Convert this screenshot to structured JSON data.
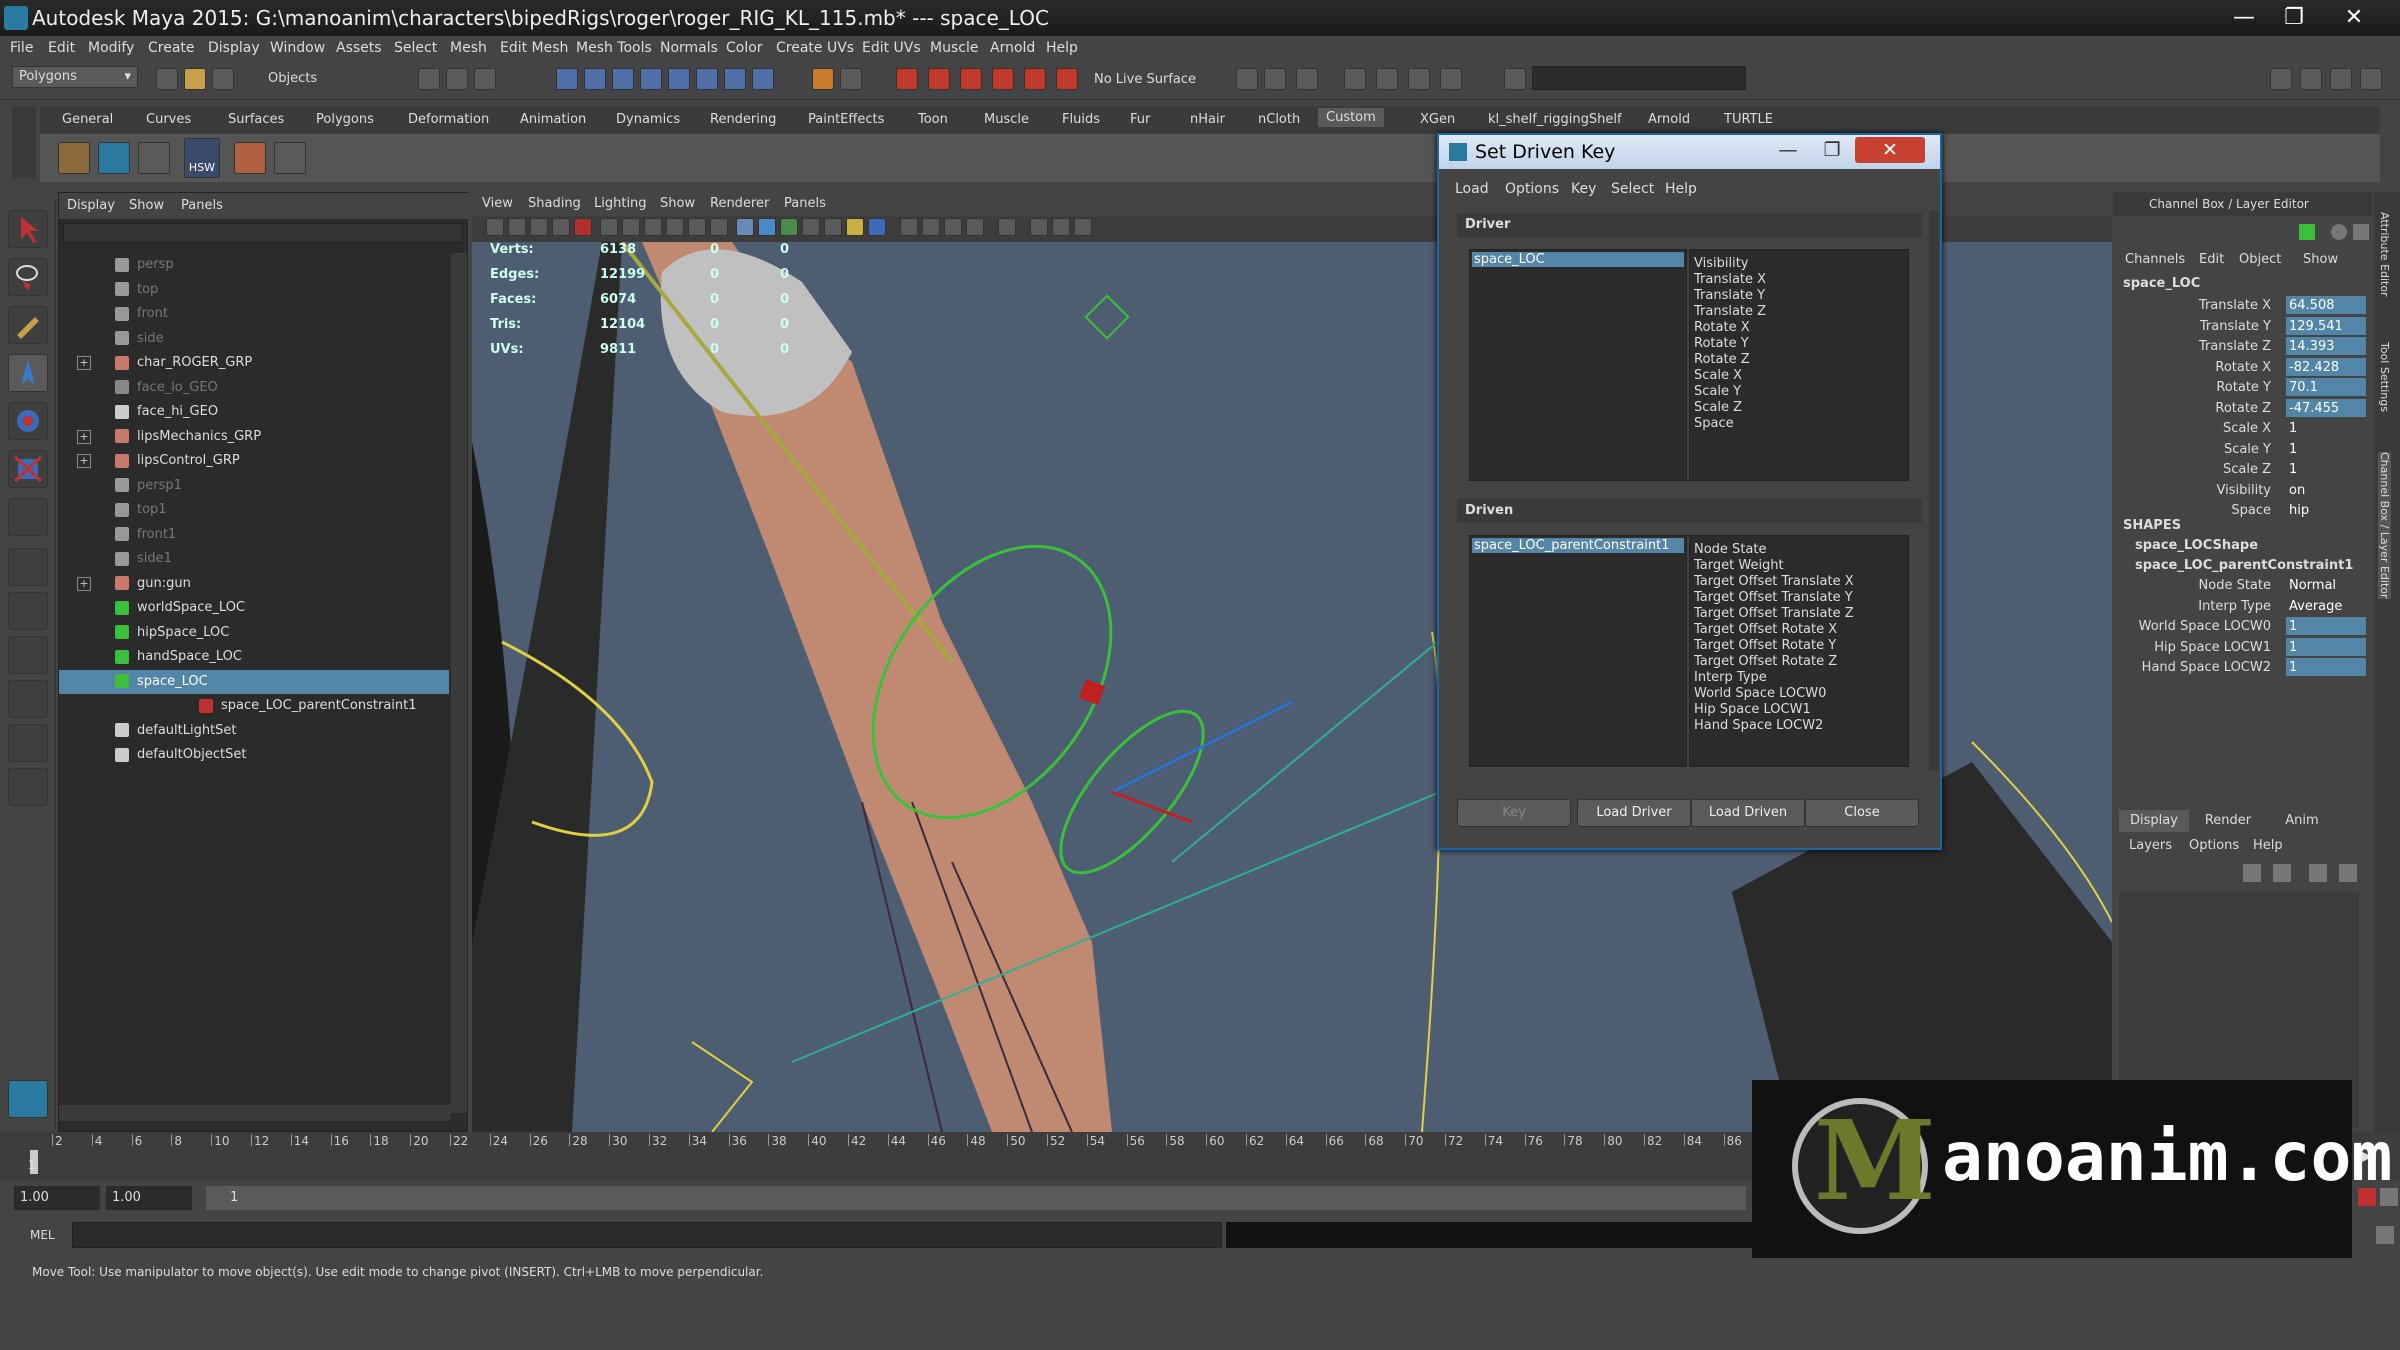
{
  "window": {
    "title": "Autodesk Maya 2015: G:\\manoanim\\characters\\bipedRigs\\roger\\roger_RIG_KL_115.mb*   ---   space_LOC",
    "controls": [
      "—",
      "❐",
      "✕"
    ]
  },
  "menubar": [
    "File",
    "Edit",
    "Modify",
    "Create",
    "Display",
    "Window",
    "Assets",
    "Select",
    "Mesh",
    "Edit Mesh",
    "Mesh Tools",
    "Normals",
    "Color",
    "Create UVs",
    "Edit UVs",
    "Muscle",
    "Arnold",
    "Help"
  ],
  "statusline": {
    "menuset": "Polygons",
    "selection_mode": "Objects",
    "live_surface": "No Live Surface"
  },
  "shelf": {
    "tabs": [
      "General",
      "Curves",
      "Surfaces",
      "Polygons",
      "Deformation",
      "Animation",
      "Dynamics",
      "Rendering",
      "PaintEffects",
      "Toon",
      "Muscle",
      "Fluids",
      "Fur",
      "nHair",
      "nCloth",
      "Custom",
      "XGen",
      "kl_shelf_riggingShelf",
      "Arnold",
      "TURTLE"
    ],
    "active_tab": "Custom",
    "hsw_label": "HSW"
  },
  "outliner": {
    "menu": [
      "Display",
      "Show",
      "Panels"
    ],
    "items": [
      {
        "label": "persp",
        "dim": true
      },
      {
        "label": "top",
        "dim": true
      },
      {
        "label": "front",
        "dim": true
      },
      {
        "label": "side",
        "dim": true
      },
      {
        "label": "char_ROGER_GRP",
        "dim": false
      },
      {
        "label": "face_lo_GEO",
        "dim": true
      },
      {
        "label": "face_hi_GEO",
        "dim": false
      },
      {
        "label": "lipsMechanics_GRP",
        "dim": false
      },
      {
        "label": "lipsControl_GRP",
        "dim": false
      },
      {
        "label": "persp1",
        "dim": true
      },
      {
        "label": "top1",
        "dim": true
      },
      {
        "label": "front1",
        "dim": true
      },
      {
        "label": "side1",
        "dim": true
      },
      {
        "label": "gun:gun",
        "dim": false
      },
      {
        "label": "worldSpace_LOC",
        "dim": false
      },
      {
        "label": "hipSpace_LOC",
        "dim": false
      },
      {
        "label": "handSpace_LOC",
        "dim": false
      },
      {
        "label": "space_LOC",
        "dim": false
      },
      {
        "label": "space_LOC_parentConstraint1",
        "dim": false
      },
      {
        "label": "defaultLightSet",
        "dim": false
      },
      {
        "label": "defaultObjectSet",
        "dim": false
      }
    ],
    "selected": "space_LOC"
  },
  "viewport": {
    "menu": [
      "View",
      "Shading",
      "Lighting",
      "Show",
      "Renderer",
      "Panels"
    ],
    "hud": [
      {
        "label": "Verts:",
        "v1": "6138",
        "v2": "0",
        "v3": "0"
      },
      {
        "label": "Edges:",
        "v1": "12199",
        "v2": "0",
        "v3": "0"
      },
      {
        "label": "Faces:",
        "v1": "6074",
        "v2": "0",
        "v3": "0"
      },
      {
        "label": "Tris:",
        "v1": "12104",
        "v2": "0",
        "v3": "0"
      },
      {
        "label": "UVs:",
        "v1": "9811",
        "v2": "0",
        "v3": "0"
      }
    ]
  },
  "set_driven_key": {
    "title": "Set Driven Key",
    "menu": [
      "Load",
      "Options",
      "Key",
      "Select",
      "Help"
    ],
    "driver_label": "Driver",
    "driver_object": "space_LOC",
    "driver_attrs": [
      "Visibility",
      "Translate X",
      "Translate Y",
      "Translate Z",
      "Rotate X",
      "Rotate Y",
      "Rotate Z",
      "Scale X",
      "Scale Y",
      "Scale Z",
      "Space"
    ],
    "driven_label": "Driven",
    "driven_object": "space_LOC_parentConstraint1",
    "driven_attrs": [
      "Node State",
      "Target Weight",
      "Target Offset Translate X",
      "Target Offset Translate Y",
      "Target Offset Translate Z",
      "Target Offset Rotate X",
      "Target Offset Rotate Y",
      "Target Offset Rotate Z",
      "Interp Type",
      "World Space LOCW0",
      "Hip Space LOCW1",
      "Hand Space LOCW2"
    ],
    "buttons": {
      "key": "Key",
      "load_driver": "Load Driver",
      "load_driven": "Load Driven",
      "close": "Close"
    }
  },
  "channel_box": {
    "title": "Channel Box / Layer Editor",
    "menu": [
      "Channels",
      "Edit",
      "Object",
      "Show"
    ],
    "object": "space_LOC",
    "attrs": [
      {
        "name": "Translate X",
        "value": "64.508",
        "hl": true
      },
      {
        "name": "Translate Y",
        "value": "129.541",
        "hl": true
      },
      {
        "name": "Translate Z",
        "value": "14.393",
        "hl": true
      },
      {
        "name": "Rotate X",
        "value": "-82.428",
        "hl": true
      },
      {
        "name": "Rotate Y",
        "value": "70.1",
        "hl": true
      },
      {
        "name": "Rotate Z",
        "value": "-47.455",
        "hl": true
      },
      {
        "name": "Scale X",
        "value": "1",
        "hl": false
      },
      {
        "name": "Scale Y",
        "value": "1",
        "hl": false
      },
      {
        "name": "Scale Z",
        "value": "1",
        "hl": false
      },
      {
        "name": "Visibility",
        "value": "on",
        "hl": false
      },
      {
        "name": "Space",
        "value": "hip",
        "hl": false
      }
    ],
    "shapes_label": "SHAPES",
    "shape1": "space_LOCShape",
    "shape2": "space_LOC_parentConstraint1",
    "shape_attrs": [
      {
        "name": "Node State",
        "value": "Normal",
        "hl": false
      },
      {
        "name": "Interp Type",
        "value": "Average",
        "hl": false
      },
      {
        "name": "World Space LOCW0",
        "value": "1",
        "hl": true
      },
      {
        "name": "Hip Space LOCW1",
        "value": "1",
        "hl": true
      },
      {
        "name": "Hand Space LOCW2",
        "value": "1",
        "hl": true
      }
    ],
    "side_tabs": [
      "Attribute Editor",
      "Tool Settings",
      "Channel Box / Layer Editor"
    ]
  },
  "layer_editor": {
    "tabs": [
      "Display",
      "Render",
      "Anim"
    ],
    "active_tab": "Display",
    "menu": [
      "Layers",
      "Options",
      "Help"
    ]
  },
  "timeline": {
    "ticks": [
      "2",
      "4",
      "6",
      "8",
      "10",
      "12",
      "14",
      "16",
      "18",
      "20",
      "22",
      "24",
      "26",
      "28",
      "30",
      "32",
      "34",
      "36",
      "38",
      "40",
      "42",
      "44",
      "46",
      "48",
      "50",
      "52",
      "54",
      "56",
      "58",
      "60",
      "62",
      "64",
      "66",
      "68",
      "70",
      "72",
      "74",
      "76",
      "78",
      "80",
      "82",
      "84",
      "86"
    ],
    "current": "1"
  },
  "range": {
    "start": "1.00",
    "current": "1.00",
    "field": "1"
  },
  "mel_label": "MEL",
  "help_text": "Move Tool: Use manipulator to move object(s). Use edit mode to change pivot (INSERT).  Ctrl+LMB to move perpendicular.",
  "watermark": {
    "letter": "M",
    "text": "anoanim.com"
  }
}
